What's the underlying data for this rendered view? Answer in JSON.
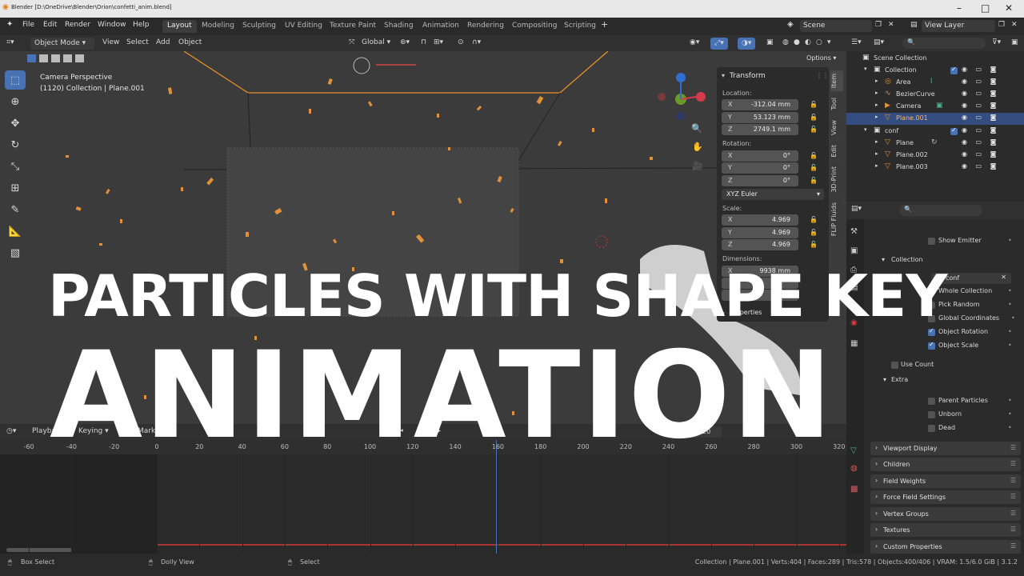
{
  "window": {
    "title": "Blender [D:\\OneDrive\\Blender\\Orion\\confetti_anim.blend]"
  },
  "menu": [
    "File",
    "Edit",
    "Render",
    "Window",
    "Help"
  ],
  "workspaces": [
    {
      "label": "Layout",
      "active": true
    },
    {
      "label": "Modeling",
      "active": false
    },
    {
      "label": "Sculpting",
      "active": false
    },
    {
      "label": "UV Editing",
      "active": false
    },
    {
      "label": "Texture Paint",
      "active": false
    },
    {
      "label": "Shading",
      "active": false
    },
    {
      "label": "Animation",
      "active": false
    },
    {
      "label": "Rendering",
      "active": false
    },
    {
      "label": "Compositing",
      "active": false
    },
    {
      "label": "Scripting",
      "active": false
    }
  ],
  "scene": "Scene",
  "view_layer": "View Layer",
  "viewport_header": {
    "mode": "Object Mode",
    "menus": [
      "View",
      "Select",
      "Add",
      "Object"
    ],
    "orientation": "Global",
    "options": "Options"
  },
  "viewport": {
    "perspective": "Camera Perspective",
    "collection": "(1120) Collection | Plane.001"
  },
  "transform_panel": {
    "title": "Transform",
    "location_label": "Location:",
    "location": [
      {
        "axis": "X",
        "value": "-312.04 mm"
      },
      {
        "axis": "Y",
        "value": "53.123 mm"
      },
      {
        "axis": "Z",
        "value": "2749.1 mm"
      }
    ],
    "rotation_label": "Rotation:",
    "rotation": [
      {
        "axis": "X",
        "value": "0°"
      },
      {
        "axis": "Y",
        "value": "0°"
      },
      {
        "axis": "Z",
        "value": "0°"
      }
    ],
    "rotation_mode": "XYZ Euler",
    "scale_label": "Scale:",
    "scale": [
      {
        "axis": "X",
        "value": "4.969"
      },
      {
        "axis": "Y",
        "value": "4.969"
      },
      {
        "axis": "Z",
        "value": "4.969"
      }
    ],
    "dimensions_label": "Dimensions:",
    "dimensions_x_axis": "X",
    "dimensions_x": "9938 mm",
    "properties_label": "Properties"
  },
  "side_tabs": [
    "Item",
    "Tool",
    "View",
    "Edit",
    "3D-Print",
    "FLIP Fluids"
  ],
  "timeline": {
    "playback": "Playback",
    "keying": "Keying",
    "markers": "Markers",
    "current_frame": "1120",
    "ticks": [
      "-60",
      "-40",
      "-20",
      "0",
      "20",
      "40",
      "60",
      "80",
      "100",
      "120",
      "140",
      "160",
      "180",
      "200",
      "220",
      "240",
      "260",
      "280",
      "300",
      "320"
    ]
  },
  "status": {
    "left": "Box Select",
    "middle": "Dolly View",
    "right_action": "Select",
    "info": "Collection | Plane.001 | Verts:404 | Faces:289 | Tris:578 | Objects:400/406 | VRAM: 1.5/6.0 GiB | 3.1.2"
  },
  "outliner": {
    "root": "Scene Collection",
    "rows": [
      {
        "name": "Collection",
        "depth": 0,
        "icon": "collection-icon",
        "selected": false
      },
      {
        "name": "Area",
        "depth": 1,
        "icon": "light-icon",
        "selected": false
      },
      {
        "name": "BezierCurve",
        "depth": 1,
        "icon": "curve-icon",
        "selected": false
      },
      {
        "name": "Camera",
        "depth": 1,
        "icon": "camera-icon",
        "selected": false
      },
      {
        "name": "Plane.001",
        "depth": 1,
        "icon": "mesh-icon",
        "selected": true
      },
      {
        "name": "conf",
        "depth": 0,
        "icon": "collection-icon",
        "selected": false
      },
      {
        "name": "Plane",
        "depth": 1,
        "icon": "mesh-icon",
        "selected": false
      },
      {
        "name": "Plane.002",
        "depth": 1,
        "icon": "mesh-icon",
        "selected": false
      },
      {
        "name": "Plane.003",
        "depth": 1,
        "icon": "mesh-icon",
        "selected": false
      }
    ]
  },
  "properties": {
    "show_emitter": "Show Emitter",
    "collection_section": "Collection",
    "collection_field": "conf",
    "whole_collection": "Whole Collection",
    "pick_random": "Pick Random",
    "global_coordinates": "Global Coordinates",
    "object_rotation": "Object Rotation",
    "object_scale": "Object Scale",
    "use_count": "Use Count",
    "extra": "Extra",
    "parent_particles": "Parent Particles",
    "unborn": "Unborn",
    "dead": "Dead",
    "sections": [
      "Viewport Display",
      "Children",
      "Field Weights",
      "Force Field Settings",
      "Vertex Groups",
      "Textures",
      "Custom Properties"
    ]
  },
  "overlay": {
    "line1": "PARTICLES WITH SHAPE KEY",
    "line2": "ANIMATION"
  },
  "colors": {
    "accent": "#4772b3",
    "confetti": "#e0913a",
    "selection_outline": "#e8902a"
  }
}
